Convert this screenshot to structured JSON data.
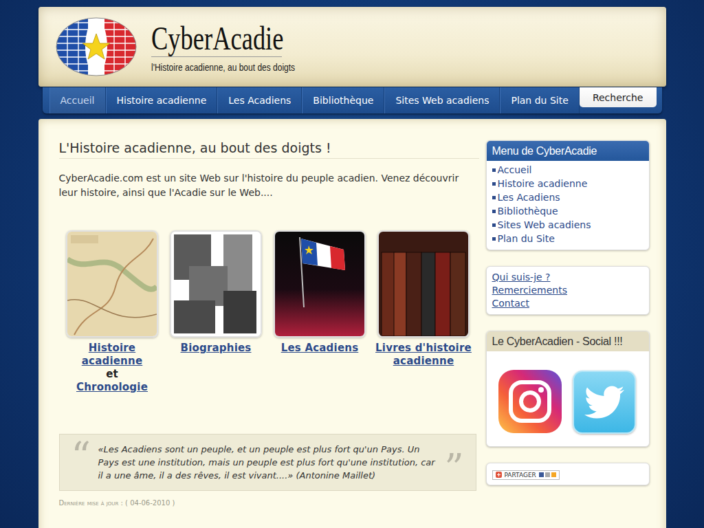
{
  "site": {
    "title": "CyberAcadie",
    "tagline": "l'Histoire acadienne, au bout des doigts"
  },
  "nav": [
    {
      "label": "Accueil",
      "selected": true
    },
    {
      "label": "Histoire acadienne",
      "selected": false
    },
    {
      "label": "Les Acadiens",
      "selected": false
    },
    {
      "label": "Bibliothèque",
      "selected": false
    },
    {
      "label": "Sites Web acadiens",
      "selected": false
    },
    {
      "label": "Plan du Site",
      "selected": false
    }
  ],
  "search": {
    "label": "Recherche"
  },
  "main": {
    "heading": "L'Histoire acadienne, au bout des doigts !",
    "intro": "CyberAcadie.com est un site Web sur l'histoire du peuple acadien. Venez découvrir leur histoire, ainsi que l'Acadie sur le Web...."
  },
  "features": [
    {
      "kind": "map",
      "parts": [
        {
          "text": "Histoire acadienne",
          "link": true
        },
        {
          "text": "et",
          "link": false
        },
        {
          "text": "Chronologie",
          "link": true
        }
      ]
    },
    {
      "kind": "portraits",
      "parts": [
        {
          "text": "Biographies",
          "link": true
        }
      ]
    },
    {
      "kind": "crowd",
      "parts": [
        {
          "text": "Les Acadiens",
          "link": true
        }
      ]
    },
    {
      "kind": "books",
      "parts": [
        {
          "text": "Livres d'histoire acadienne",
          "link": true
        }
      ]
    }
  ],
  "quote": {
    "open_mark": "“",
    "close_mark": "”",
    "text": "«Les Acadiens sont un peuple, et un peuple est plus fort qu'un Pays. Un Pays est une institution, mais un peuple est plus fort qu'une institution, car il a une âme, il a des rêves, il est vivant....» (Antonine Maillet)"
  },
  "updated": "Dernière mise à jour : ( 04-06-2010 )",
  "menu": {
    "title": "Menu de CyberAcadie",
    "items": [
      "Accueil",
      "Histoire acadienne",
      "Les Acadiens",
      "Bibliothèque",
      "Sites Web acadiens",
      "Plan du Site"
    ]
  },
  "links": [
    "Qui suis-je ?",
    "Remerciements",
    "Contact"
  ],
  "social": {
    "title": "Le CyberAcadien - Social !!!"
  },
  "share": {
    "label": "PARTAGER"
  }
}
